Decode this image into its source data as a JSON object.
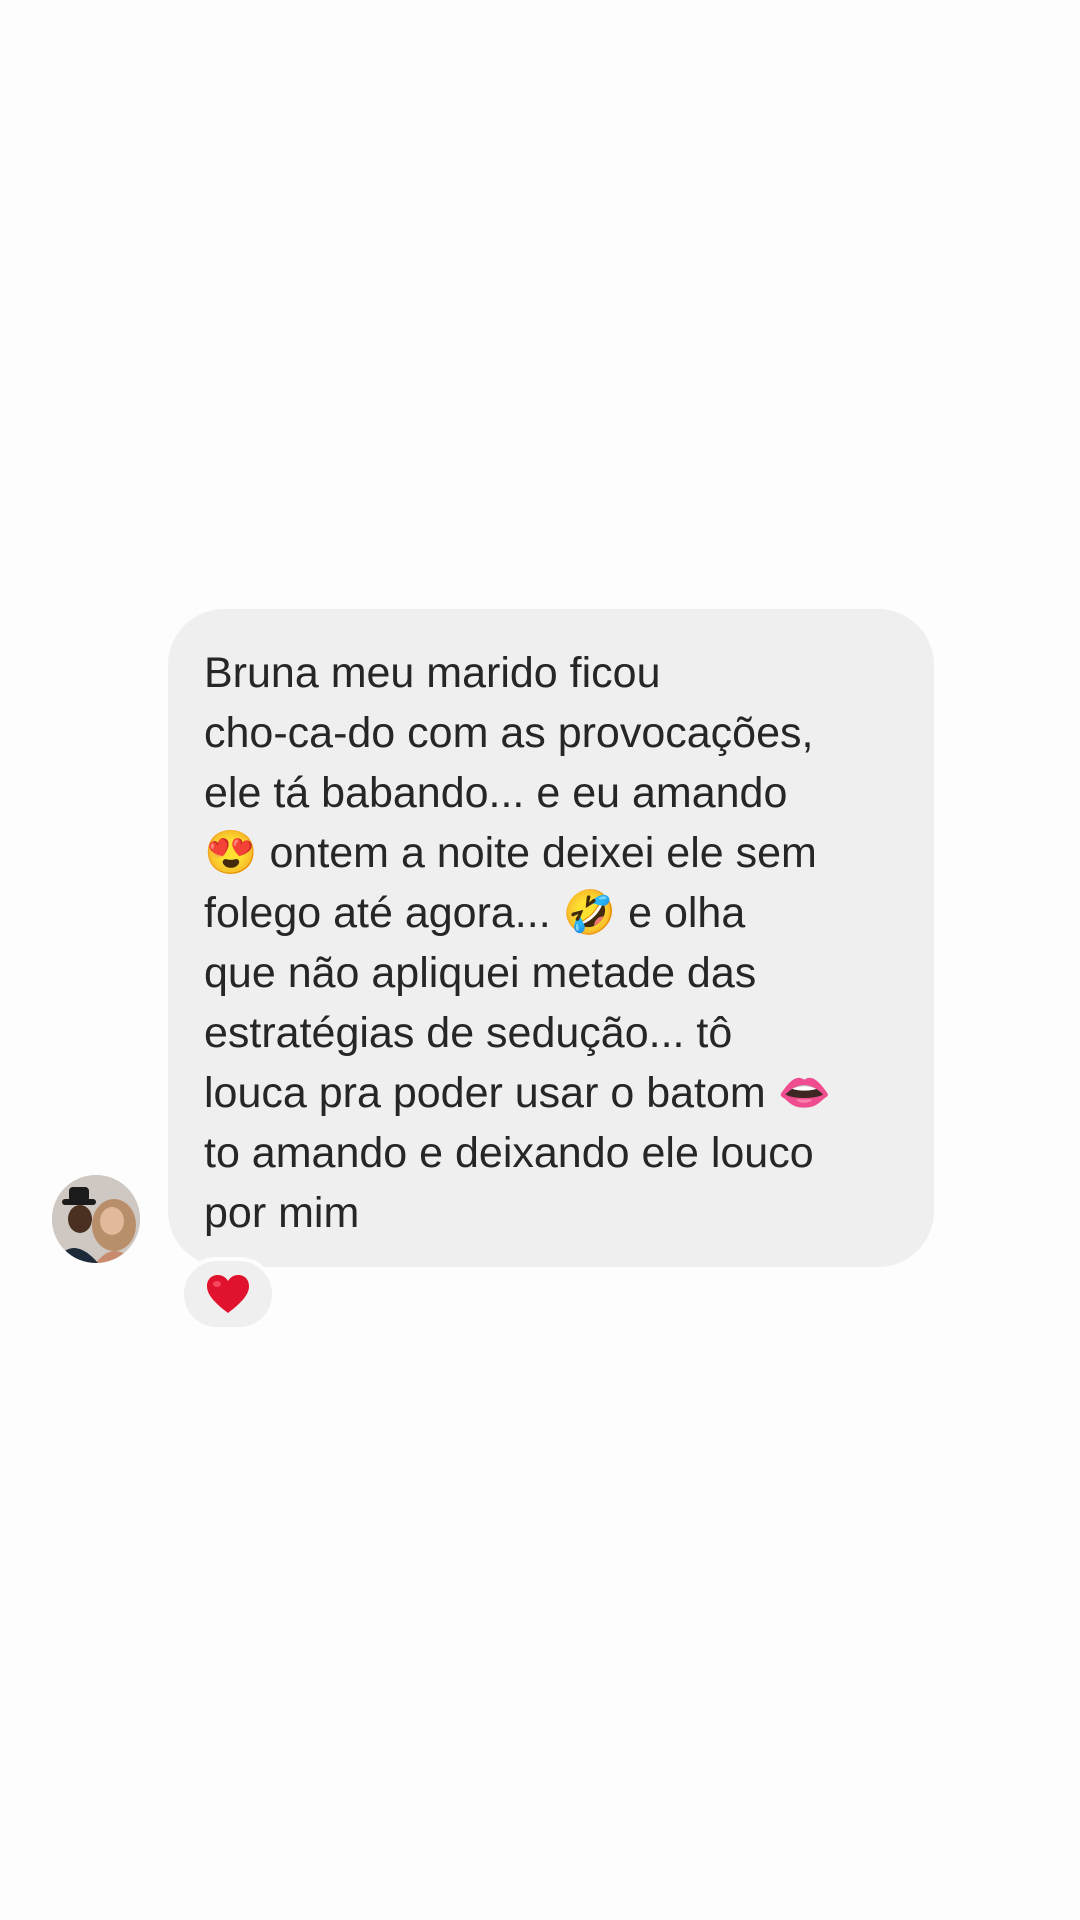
{
  "conversation": {
    "message": {
      "lines": [
        "Bruna meu marido ficou",
        "cho-ca-do com as provocações,",
        "ele tá babando... e eu amando",
        "😍 ontem a noite deixei ele sem",
        "folego até agora... 🤣 e olha",
        "que não apliquei metade das",
        "estratégias de sedução... tô",
        "louca pra poder usar o batom 👄",
        "to amando e deixando ele louco",
        "por mim"
      ],
      "reaction": "heart",
      "sender_avatar": "avatar-photo-couple"
    }
  },
  "colors": {
    "background": "#fdfdfd",
    "bubble": "#efefef",
    "text": "#262626",
    "heart": "#e0122d"
  }
}
